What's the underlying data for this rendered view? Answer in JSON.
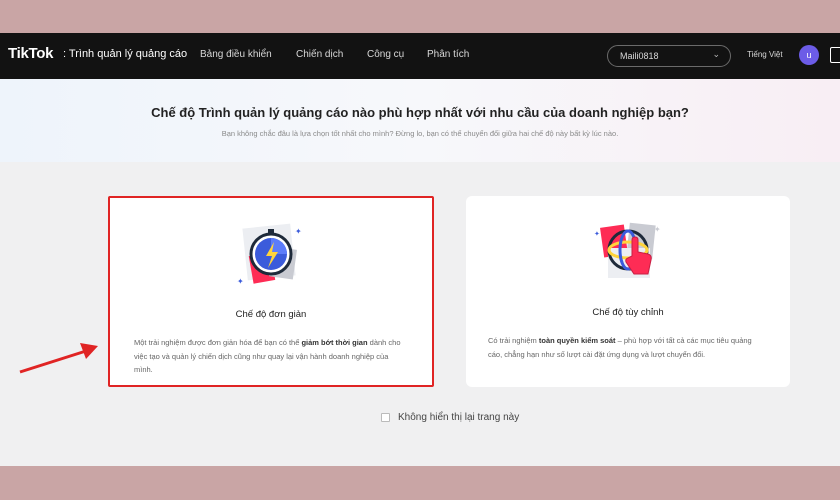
{
  "header": {
    "logo": "TikTok",
    "logo_suffix": ": Trình quản lý quảng cáo",
    "nav": [
      "Bảng điều khiển",
      "Chiến dịch",
      "Công cụ",
      "Phân tích"
    ],
    "account": "Maili0818",
    "language": "Tiếng Việt",
    "avatar_initial": "u"
  },
  "hero": {
    "title": "Chế độ Trình quản lý quảng cáo nào phù hợp nhất với nhu cầu của doanh nghiệp bạn?",
    "subtitle": "Bạn không chắc đâu là lựa chọn tốt nhất cho mình? Đừng lo, bạn có thể chuyển đổi giữa hai chế độ này bất kỳ lúc nào."
  },
  "cards": {
    "simple": {
      "title": "Chế độ đơn giản",
      "desc_before": "Một trải nghiệm được đơn giản hóa để bạn có thể ",
      "desc_bold": "giảm bớt thời gian",
      "desc_after": " dành cho việc tạo và quản lý chiến dịch cũng như quay lại vận hành doanh nghiệp của mình."
    },
    "custom": {
      "title": "Chế độ tùy chỉnh",
      "desc_before": "Có trải nghiệm ",
      "desc_bold": "toàn quyền kiểm soát",
      "desc_after": " – phù hợp với tất cả các mục tiêu quảng cáo, chẳng hạn như số lượt cài đặt ứng dụng và lượt chuyển đổi."
    }
  },
  "footer": {
    "dont_show_label": "Không hiển thị lại trang này",
    "dont_show_checked": false
  },
  "colors": {
    "nav_bg": "#121212",
    "highlight": "#e02424",
    "accent": "#fe2c55",
    "avatar": "#6c5ce7"
  }
}
